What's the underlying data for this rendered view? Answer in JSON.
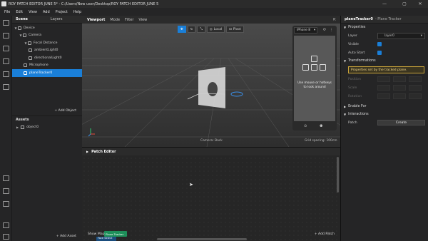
{
  "title": "ROY PATCH EDITOR JUNE 5* - C:/Users/New user/Desktop/ROY PATCH EDITOR JUNE 5",
  "window_controls": [
    "—",
    "▢",
    "✕"
  ],
  "menu": [
    "File",
    "Edit",
    "View",
    "Add",
    "Project",
    "Help"
  ],
  "scene": {
    "tabs": [
      "Scene",
      "Layers"
    ],
    "items": [
      {
        "label": "Device",
        "icon": "device-icon"
      },
      {
        "label": "Camera",
        "icon": "camera-icon"
      },
      {
        "label": "Focal Distance",
        "icon": "focal-distance-icon"
      },
      {
        "label": "ambientLight0",
        "icon": "light-icon"
      },
      {
        "label": "directionalLight0",
        "icon": "light-icon"
      },
      {
        "label": "Microphone",
        "icon": "microphone-icon"
      },
      {
        "label": "planeTracker0",
        "icon": "plane-tracker-icon",
        "selected": true
      }
    ],
    "add_object": "+ Add Object"
  },
  "assets": {
    "title": "Assets",
    "items": [
      "object0"
    ],
    "add_asset": "+ Add Asset"
  },
  "viewport": {
    "tabs": [
      "Viewport",
      "Mode",
      "Filter",
      "View"
    ],
    "tools": [
      "Local",
      "Pivot"
    ],
    "device": "iPhone 8",
    "device_message": "Use mouse or hotkeys to look around",
    "camera_label": "Camera: Back",
    "grid_label": "Grid spacing: 100cm"
  },
  "patch_editor": {
    "title": "Patch Editor",
    "show_map": "Show Map",
    "add_patch": "+ Add Patch",
    "nodes": [
      "Plane Tracker",
      "Face Select"
    ]
  },
  "properties": {
    "title": "planeTracker0",
    "subtitle": "- Plane Tracker",
    "sections": {
      "properties": "Properties",
      "transformations": "Transformations",
      "enable_for": "Enable For",
      "interactions": "Interactions"
    },
    "layer_label": "Layer",
    "layer_value": "layer0",
    "visible_label": "Visible",
    "auto_start_label": "Auto Start",
    "tooltip": "Properties set by the tracked plane.",
    "position": "Position",
    "scale": "Scale",
    "rotation": "Rotation",
    "patch_label": "Patch",
    "create": "Create"
  }
}
